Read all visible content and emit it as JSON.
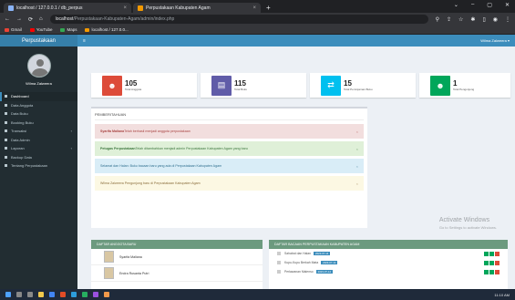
{
  "browser": {
    "tabs": [
      {
        "title": "localhost / 127.0.0.1 / db_perpus",
        "close": "×"
      },
      {
        "title": "Perpustakaan Kabupaten Agam",
        "close": "×"
      }
    ],
    "new_tab": "+",
    "window_controls": [
      "⌄",
      "–",
      "▢",
      "✕"
    ],
    "url_host": "localhost",
    "url_path": "/Perpustakaan-Kabupaten-Agam/admin/index.php",
    "bookmarks": [
      "Gmail",
      "YouTube",
      "Maps",
      "localhost / 127.0.0..."
    ]
  },
  "sidebar": {
    "brand": "Perpustakaan",
    "user_name": "Wilma Zalweera",
    "items": [
      {
        "label": "Dashboard",
        "has_arrow": false
      },
      {
        "label": "Data Anggota",
        "has_arrow": false
      },
      {
        "label": "Data Buku",
        "has_arrow": false
      },
      {
        "label": "Booking Buku",
        "has_arrow": false
      },
      {
        "label": "Transaksi",
        "has_arrow": true
      },
      {
        "label": "Data Admin",
        "has_arrow": false
      },
      {
        "label": "Laporan",
        "has_arrow": true
      },
      {
        "label": "Backup Data",
        "has_arrow": false
      },
      {
        "label": "Tentang Perpustakaan",
        "has_arrow": false
      }
    ]
  },
  "topnav": {
    "toggle": "≡",
    "user": "Wilma Zalweera ▾"
  },
  "stats": [
    {
      "number": "105",
      "label": "Total Anggota",
      "color": "#dd4b39",
      "icon": "user-icon"
    },
    {
      "number": "115",
      "label": "Total Buku",
      "color": "#605ca8",
      "icon": "book-icon"
    },
    {
      "number": "15",
      "label": "Total Peminjaman Buku",
      "color": "#00c0ef",
      "icon": "exchange-icon"
    },
    {
      "number": "1",
      "label": "Total Pengunjung",
      "color": "#00a65a",
      "icon": "users-icon"
    }
  ],
  "announcements": {
    "header": "PEMBERITAHUAN",
    "close": "×",
    "alerts": [
      {
        "type": "danger",
        "strong": "Syarifa Maliana",
        "text": " Telah berhasil menjadi anggota perpustakaan"
      },
      {
        "type": "success",
        "strong": "Petugas Perpustakaan",
        "text": " Telah ditambahkan menjadi admin Perpustakaan Kabupaten Agam yang baru"
      },
      {
        "type": "info",
        "strong": "",
        "text": "Selamat dan Halan: Buku bacaan baru yang ada di Perpustakaan Kabupaten Agam"
      },
      {
        "type": "warning",
        "strong": "",
        "text": "Wilma Zalweera Pengunjung baru di Perpustakaan Kabupaten Agam"
      }
    ]
  },
  "new_members": {
    "header": "DAFTAR ANGGOTA BARU",
    "members": [
      "Syarifa Maliana",
      "Endra Rusanta Putri"
    ]
  },
  "new_books": {
    "header": "DAFTAR BACAAN PERPUSTAKAAN KABUPATEN AGAM",
    "books": [
      {
        "title": "Sahabat dan Halan",
        "tag": "2023-07-14"
      },
      {
        "title": "Kupu-Kupu Berkah Mata",
        "tag": "2023-07-14"
      },
      {
        "title": "Perlawanan Malenso",
        "tag": "2023-07-14"
      }
    ]
  },
  "watermark": {
    "title": "Activate Windows",
    "subtitle": "Go to Settings to activate Windows."
  },
  "taskbar": {
    "clock": "11:10 AM"
  }
}
